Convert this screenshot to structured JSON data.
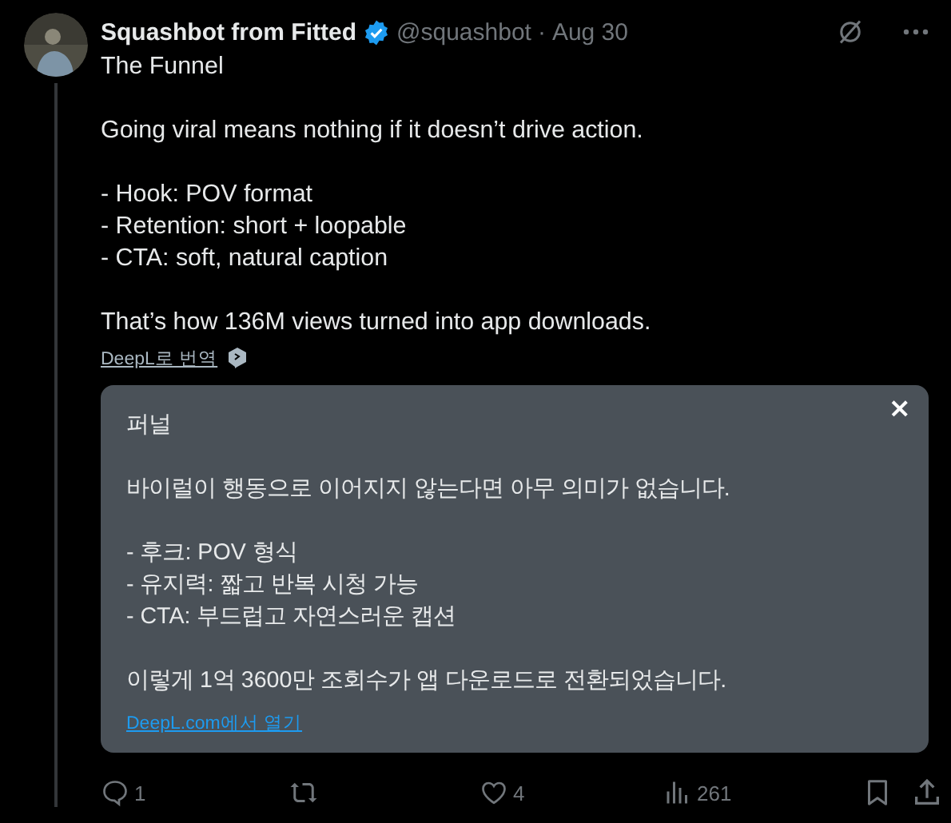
{
  "author": {
    "name": "Squashbot from Fitted",
    "verified": true,
    "handle": "@squashbot",
    "separator": "·",
    "date": "Aug 30"
  },
  "body": [
    [
      "The Funnel"
    ],
    [
      "Going viral means nothing if it doesn’t drive action."
    ],
    [
      "- Hook: POV format",
      "- Retention: short + loopable",
      "- CTA: soft, natural caption"
    ],
    [
      "That’s how 136M views turned into app downloads."
    ]
  ],
  "translate_link": "DeepL로 번역",
  "translation": {
    "close": "×",
    "paragraphs": [
      [
        "퍼널"
      ],
      [
        "바이럴이 행동으로 이어지지 않는다면 아무 의미가 없습니다."
      ],
      [
        "- 후크: POV 형식",
        "- 유지력: 짧고 반복 시청 가능",
        "- CTA: 부드럽고 자연스러운 캡션"
      ],
      [
        "이렇게 1억 3600만 조회수가 앱 다운로드로 전환되었습니다."
      ]
    ],
    "link": "DeepL.com에서 열기"
  },
  "actions": [
    {
      "kind": "reply",
      "count": "1"
    },
    {
      "kind": "repost"
    },
    {
      "kind": "like",
      "count": "4"
    },
    {
      "kind": "views",
      "count": "261"
    },
    {
      "kind": "bookmark"
    },
    {
      "kind": "share"
    }
  ]
}
